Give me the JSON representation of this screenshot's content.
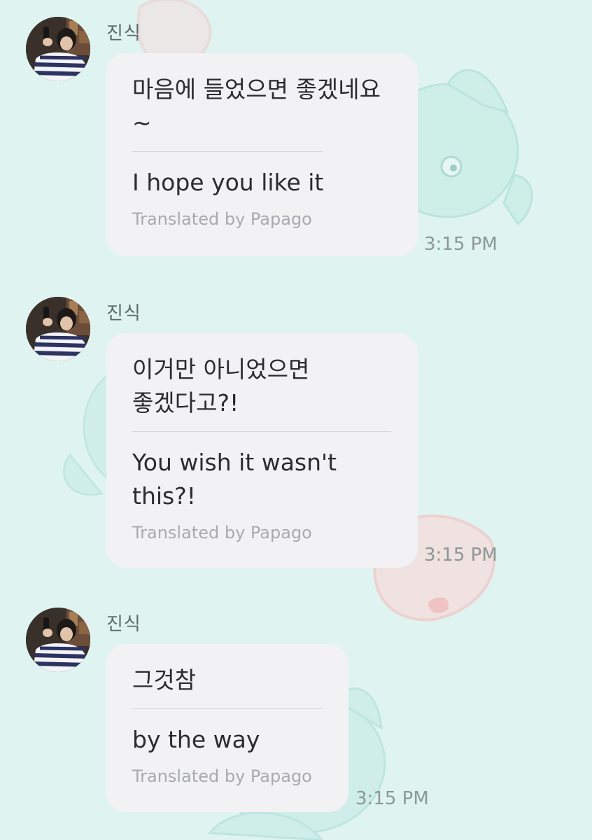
{
  "colors": {
    "background": "#dff4f1",
    "bubble": "#f2f2f4",
    "text": "#2c2c2e",
    "muted": "#a9aab0"
  },
  "messages": [
    {
      "sender": "진식",
      "original": "마음에 들었으면 좋겠네요~",
      "translated": "I hope you like it",
      "credit": "Translated by Papago",
      "time": "3:15 PM",
      "avatar_icon": "profile-photo"
    },
    {
      "sender": "진식",
      "original": "이거만 아니었으면 좋겠다고?!",
      "translated": "You wish it wasn't this?!",
      "credit": "Translated by Papago",
      "time": "3:15 PM",
      "avatar_icon": "profile-photo"
    },
    {
      "sender": "진식",
      "original": "그것참",
      "translated": "by the way",
      "credit": "Translated by Papago",
      "time": "3:15 PM",
      "avatar_icon": "profile-photo"
    }
  ]
}
